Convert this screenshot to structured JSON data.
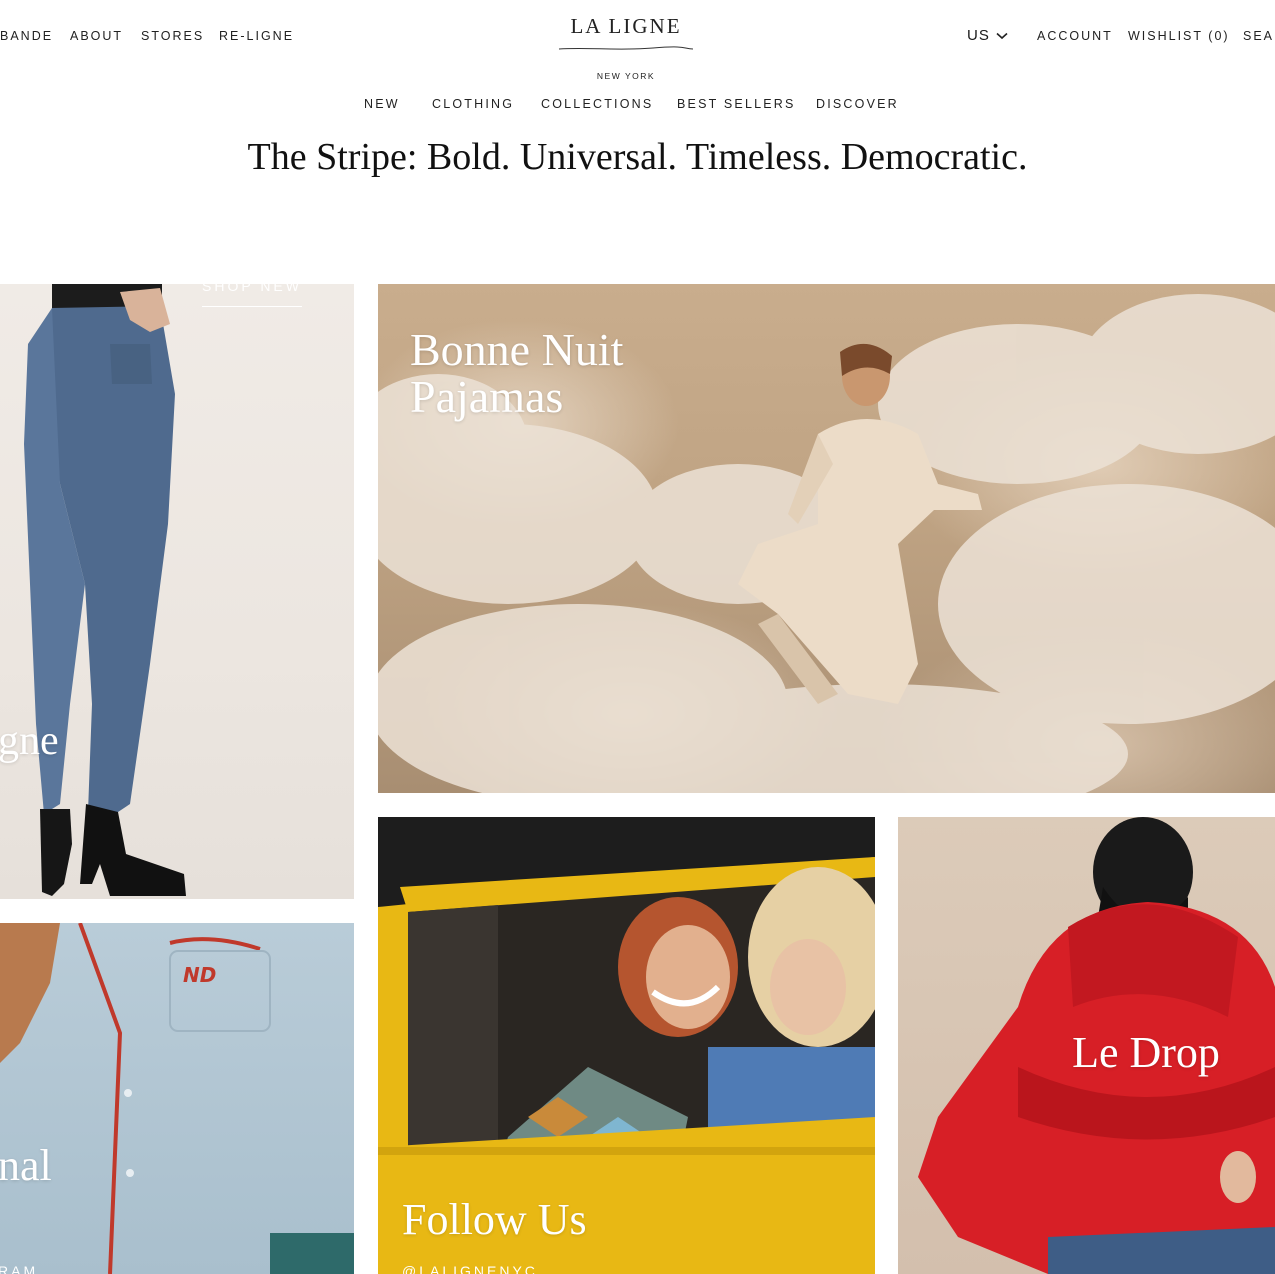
{
  "header": {
    "utility_left": [
      "BANDE",
      "ABOUT",
      "STORES",
      "RE-LIGNE"
    ],
    "logo": {
      "name": "LA LIGNE",
      "subtitle": "NEW YORK"
    },
    "country": {
      "label": "US",
      "icon": "chevron-down-icon"
    },
    "utility_right": {
      "account": "ACCOUNT",
      "wishlist": "WISHLIST (0)",
      "search": "SEAR"
    }
  },
  "nav": [
    "NEW",
    "CLOTHING",
    "COLLECTIONS",
    "BEST SELLERS",
    "DISCOVER"
  ],
  "headline": "The Stripe: Bold. Universal. Timeless. Democratic.",
  "tiles": {
    "jeans": {
      "title": "gne"
    },
    "pajamas": {
      "title_line1": "Bonne Nuit",
      "title_line2": "Pajamas"
    },
    "shirt": {
      "title": "nal",
      "subtitle": "RAM",
      "embroidery": "ND"
    },
    "follow": {
      "title": "Follow Us",
      "handle": "@LALIGNENYC"
    },
    "drop": {
      "title": "Le Drop",
      "cta": "SHOP NEW"
    }
  },
  "colors": {
    "text": "#1a1a1a",
    "overlay_text": "#ffffff",
    "taxi_yellow": "#e8b814",
    "sweater_red": "#d71f26",
    "denim_blue": "#4f6a8e"
  }
}
